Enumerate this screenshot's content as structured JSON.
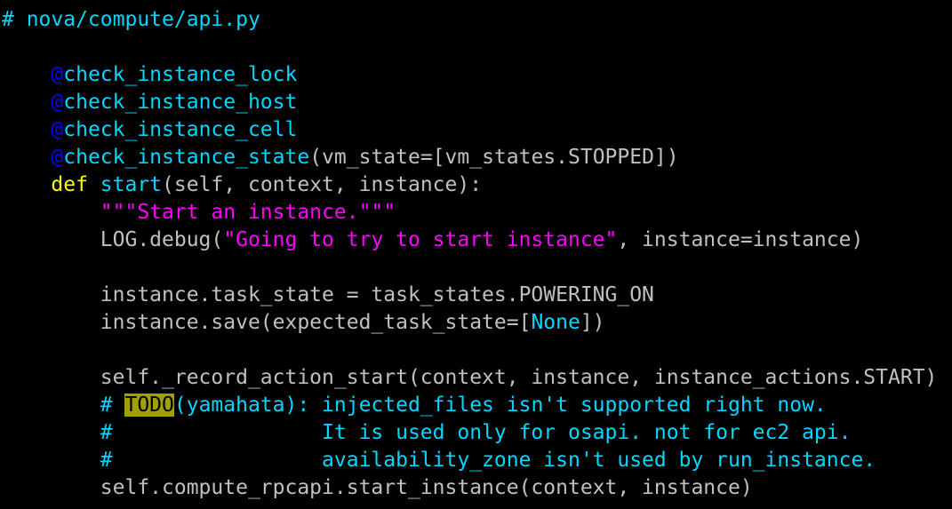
{
  "colors": {
    "background": "#000000",
    "text": "#c0c0c0",
    "comment": "#00d7ff",
    "decorator": "#0000ff",
    "keyword": "#ffff00",
    "function_name": "#00d7ff",
    "string": "#ff00ff",
    "builtin_constant": "#00d7ff",
    "todo_highlight_bg": "#a0a000",
    "todo_highlight_fg": "#000000"
  },
  "code": {
    "lines": [
      [
        {
          "t": "# nova/compute/api.py",
          "k": "comment"
        }
      ],
      [],
      [
        {
          "t": "    ",
          "k": "text"
        },
        {
          "t": "@",
          "k": "decorator"
        },
        {
          "t": "check_instance_lock",
          "k": "funcname"
        }
      ],
      [
        {
          "t": "    ",
          "k": "text"
        },
        {
          "t": "@",
          "k": "decorator"
        },
        {
          "t": "check_instance_host",
          "k": "funcname"
        }
      ],
      [
        {
          "t": "    ",
          "k": "text"
        },
        {
          "t": "@",
          "k": "decorator"
        },
        {
          "t": "check_instance_cell",
          "k": "funcname"
        }
      ],
      [
        {
          "t": "    ",
          "k": "text"
        },
        {
          "t": "@",
          "k": "decorator"
        },
        {
          "t": "check_instance_state",
          "k": "funcname"
        },
        {
          "t": "(vm_state=[vm_states.STOPPED])",
          "k": "text"
        }
      ],
      [
        {
          "t": "    ",
          "k": "text"
        },
        {
          "t": "def",
          "k": "keyword"
        },
        {
          "t": " ",
          "k": "text"
        },
        {
          "t": "start",
          "k": "funcname"
        },
        {
          "t": "(self, context, instance):",
          "k": "text"
        }
      ],
      [
        {
          "t": "        ",
          "k": "text"
        },
        {
          "t": "\"\"\"Start an instance.\"\"\"",
          "k": "string"
        }
      ],
      [
        {
          "t": "        LOG.debug(",
          "k": "text"
        },
        {
          "t": "\"Going to try to start instance\"",
          "k": "string"
        },
        {
          "t": ", instance=instance)",
          "k": "text"
        }
      ],
      [],
      [
        {
          "t": "        instance.task_state = task_states.POWERING_ON",
          "k": "text"
        }
      ],
      [
        {
          "t": "        instance.save(expected_task_state=[",
          "k": "text"
        },
        {
          "t": "None",
          "k": "builtin"
        },
        {
          "t": "])",
          "k": "text"
        }
      ],
      [],
      [
        {
          "t": "        self._record_action_start(context, instance, instance_actions.START)",
          "k": "text"
        }
      ],
      [
        {
          "t": "        ",
          "k": "text"
        },
        {
          "t": "# ",
          "k": "comment"
        },
        {
          "t": "TODO",
          "k": "todo"
        },
        {
          "t": "(yamahata): injected_files isn't supported right now.",
          "k": "comment"
        }
      ],
      [
        {
          "t": "        ",
          "k": "text"
        },
        {
          "t": "#                 It is used only for osapi. not for ec2 api.",
          "k": "comment"
        }
      ],
      [
        {
          "t": "        ",
          "k": "text"
        },
        {
          "t": "#                 availability_zone isn't used by run_instance.",
          "k": "comment"
        }
      ],
      [
        {
          "t": "        self.compute_rpcapi.start_instance(context, instance)",
          "k": "text"
        }
      ]
    ]
  }
}
